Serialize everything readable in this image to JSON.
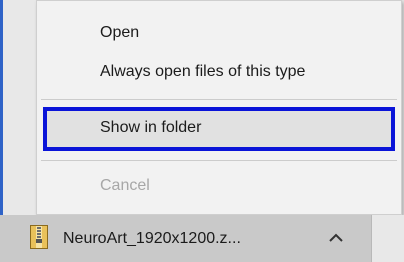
{
  "context_menu": {
    "items": [
      {
        "label": "Open",
        "enabled": true
      },
      {
        "label": "Always open files of this type",
        "enabled": true
      },
      {
        "label": "Show in folder",
        "enabled": true,
        "highlighted": true
      },
      {
        "label": "Cancel",
        "enabled": false
      }
    ]
  },
  "download_shelf": {
    "item": {
      "filename": "NeuroArt_1920x1200.z...",
      "file_icon": "zip-file-icon",
      "menu_icon": "chevron-up-icon"
    }
  },
  "colors": {
    "highlight_border": "#0a14d8",
    "menu_background": "#f2f2f2",
    "download_item_background": "#c9c9c9"
  }
}
